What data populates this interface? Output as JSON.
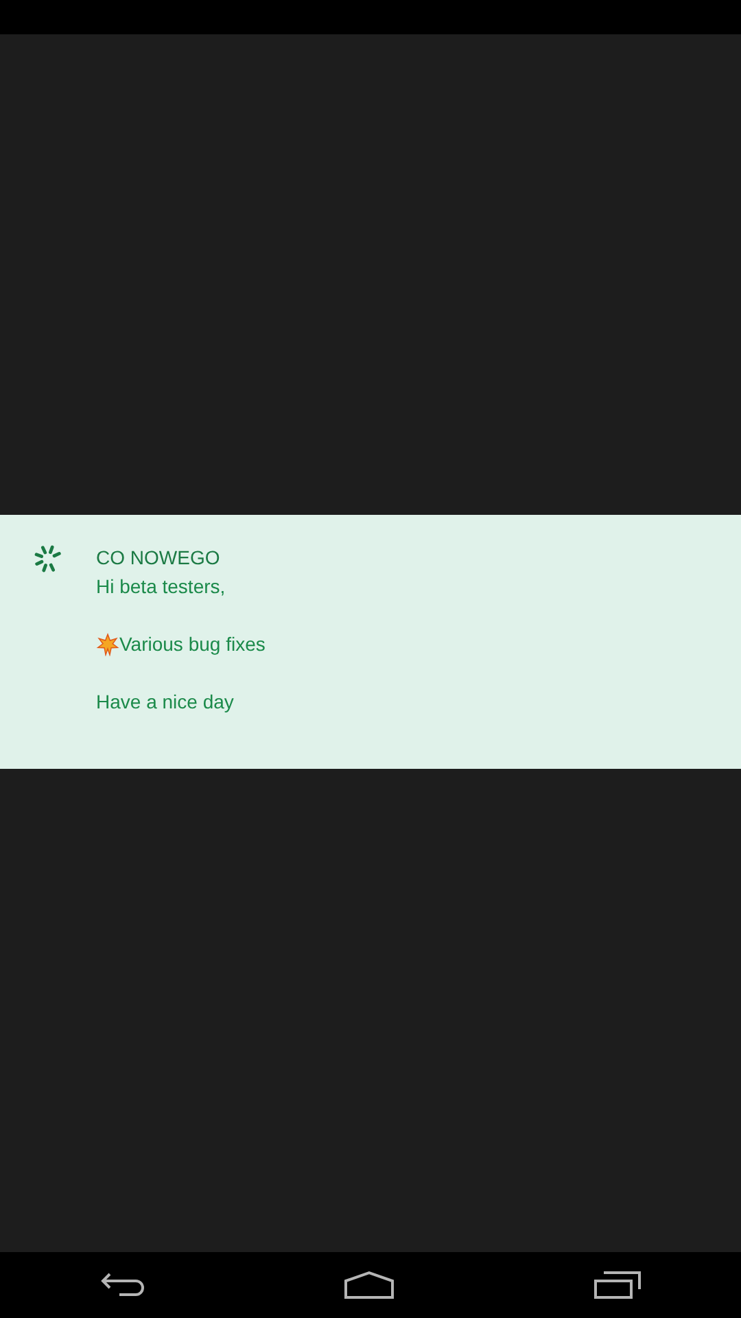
{
  "notification": {
    "title": "CO NOWEGO",
    "lines": [
      {
        "kind": "text",
        "text": "Hi beta testers,"
      },
      {
        "kind": "gap"
      },
      {
        "kind": "starred",
        "text": "Various bug fixes"
      },
      {
        "kind": "gap"
      },
      {
        "kind": "text",
        "text": "Have a nice day"
      }
    ]
  }
}
